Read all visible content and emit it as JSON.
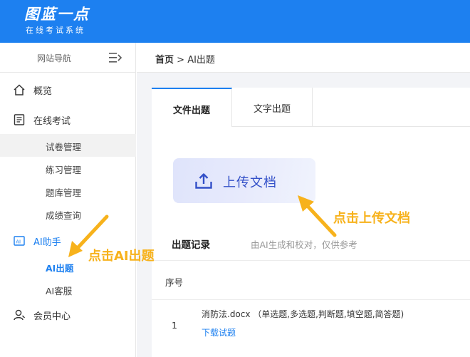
{
  "header": {
    "brand_title": "图蓝一点",
    "brand_subtitle": "在线考试系统"
  },
  "sidebar": {
    "head_label": "网站导航",
    "menu": [
      {
        "label": "概览",
        "icon": "home-icon"
      },
      {
        "label": "在线考试",
        "icon": "exam-list-icon",
        "children": [
          "试卷管理",
          "练习管理",
          "题库管理",
          "成绩查询"
        ]
      },
      {
        "label": "AI助手",
        "icon": "ai-icon",
        "children": [
          "AI出题",
          "AI客服"
        ]
      },
      {
        "label": "会员中心",
        "icon": "user-icon"
      }
    ]
  },
  "breadcrumb": {
    "home": "首页",
    "separator": ">",
    "current": "AI出题"
  },
  "tabs": [
    {
      "label": "文件出题",
      "active": true
    },
    {
      "label": "文字出题",
      "active": false
    }
  ],
  "upload": {
    "label": "上传文档"
  },
  "records": {
    "title": "出题记录",
    "note": "由AI生成和校对，仅供参考",
    "columns": [
      "序号"
    ],
    "rows": [
      {
        "no": "1",
        "file": "消防法.docx （单选题,多选题,判断题,填空题,简答题)",
        "action": "下载试题"
      }
    ]
  },
  "annotations": {
    "left": "点击AI出题",
    "right": "点击上传文档"
  },
  "colors": {
    "primary": "#1d80f0",
    "annotation": "#f7b21c",
    "upload_text": "#3350c8"
  }
}
